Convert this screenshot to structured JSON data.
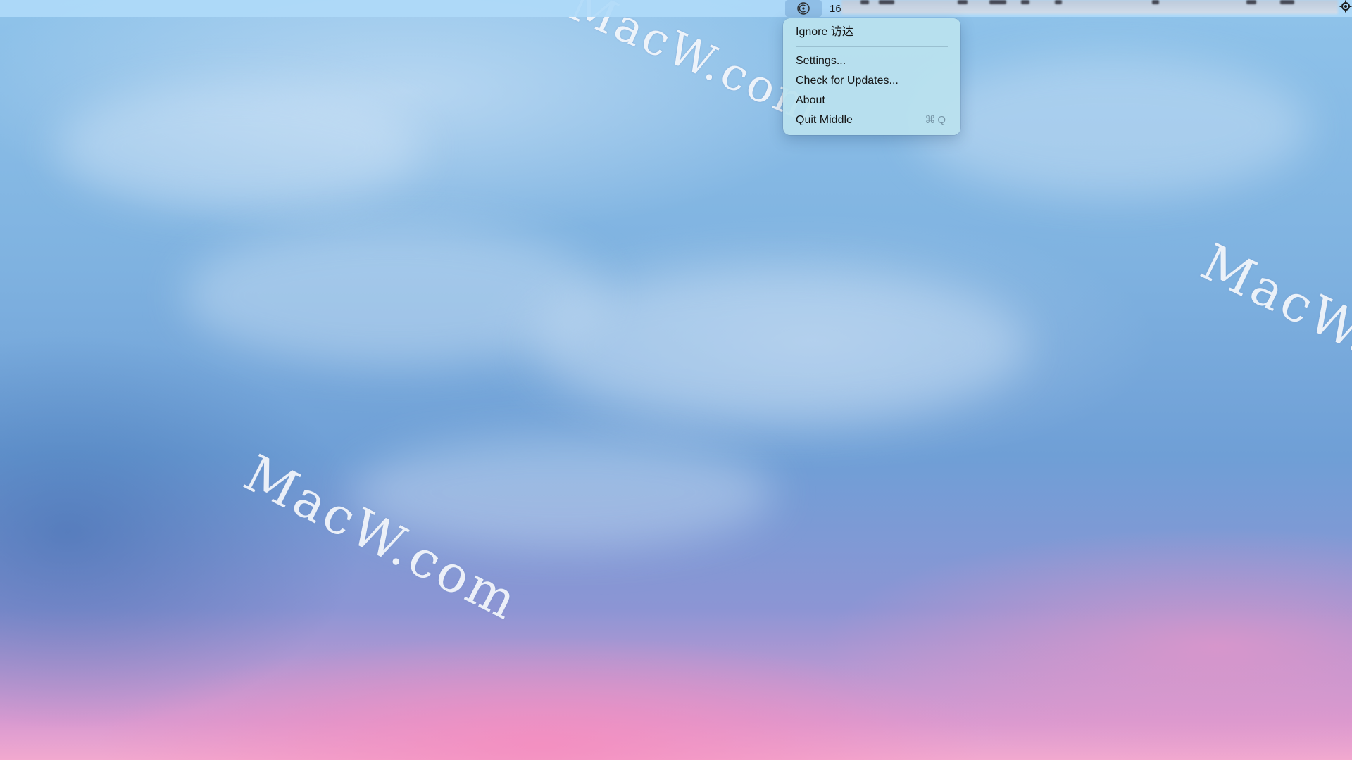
{
  "menubar": {
    "app_icon": "middle-app-icon",
    "counter": "16",
    "right_icon": "gear-icon"
  },
  "menu": {
    "items": [
      {
        "label": "Ignore 访达",
        "shortcut": ""
      },
      {
        "label": "Settings...",
        "shortcut": ""
      },
      {
        "label": "Check for Updates...",
        "shortcut": ""
      },
      {
        "label": "About",
        "shortcut": ""
      },
      {
        "label": "Quit Middle",
        "shortcut": "⌘Q"
      }
    ]
  },
  "watermarks": {
    "top": "MacW.com",
    "middle": "MacW.com",
    "right": "MacW.com"
  },
  "colors": {
    "menubar": "#afdaf8",
    "menu_background": "#bae1ee",
    "text": "#141414"
  }
}
